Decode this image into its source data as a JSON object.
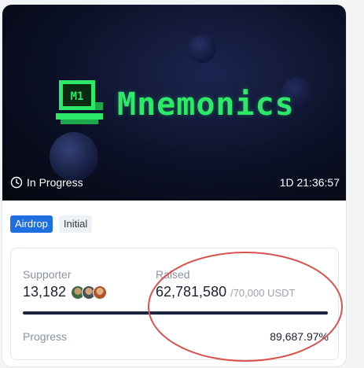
{
  "banner": {
    "logo_mark_text": "M1",
    "logo_text": "Mnemonics",
    "status": "In Progress",
    "countdown": "1D 21:36:57",
    "accent_color": "#2ee86a"
  },
  "tags": [
    "Airdrop",
    "Initial"
  ],
  "stats": {
    "supporter_label": "Supporter",
    "supporter_count": "13,182",
    "raised_label": "Raised",
    "raised_amount": "62,781,580",
    "raised_goal": "/70,000 USDT",
    "progress_label": "Progress",
    "progress_percent": "89,687.97%",
    "progress_fraction": 1.0
  },
  "colors": {
    "tag_primary": "#1f6fe0",
    "progress": "#1a2540",
    "annotation": "#d9534f"
  }
}
